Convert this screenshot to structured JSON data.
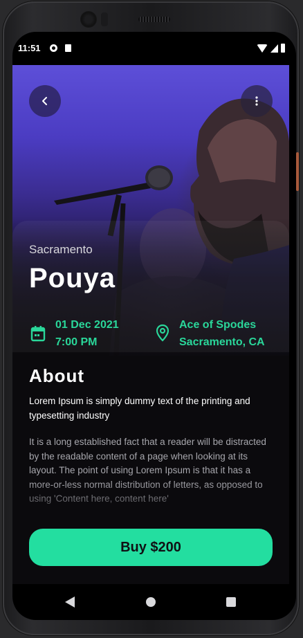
{
  "status_bar": {
    "time": "11:51"
  },
  "event": {
    "city": "Sacramento",
    "artist": "Pouya",
    "date": "01 Dec 2021",
    "time": "7:00 PM",
    "venue": "Ace of Spodes",
    "venue_city": "Sacramento, CA"
  },
  "about": {
    "title": "About",
    "lead": "Lorem Ipsum is simply dummy text of the printing and typesetting industry",
    "body": "It is a long established fact that a reader will be distracted by the readable content of a page when looking at its layout. The point of using Lorem Ipsum is that it has a more-or-less normal distribution of letters, as opposed to using 'Content here, content here'"
  },
  "actions": {
    "buy_label": "Buy $200"
  },
  "colors": {
    "accent": "#23dea0",
    "background": "#0b0a0d",
    "hero_purple": "#5d4fd8"
  },
  "icons": {
    "back": "chevron-left-icon",
    "more": "more-vertical-icon",
    "date": "calendar-icon",
    "venue": "map-pin-icon"
  }
}
